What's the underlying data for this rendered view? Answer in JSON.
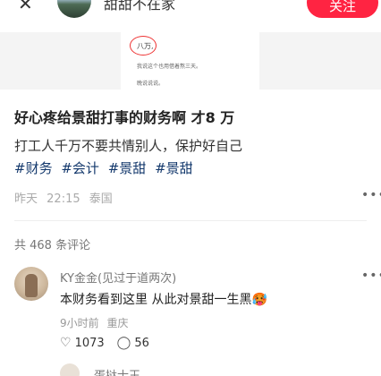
{
  "topbar": {
    "close_icon": "close-icon",
    "username": "甜甜不在家",
    "follow_label": "关注",
    "accent": "#ff2442"
  },
  "preview": {
    "line1": "八万,",
    "line2": "我说这个也用借着熬三天。",
    "line3": "晚说说说。"
  },
  "post": {
    "title": "好心疼给景甜打事的财务啊 才8 万",
    "description": "打工人千万不要共情别人，保护好自己",
    "tags": [
      "#财务",
      "#会计",
      "#景甜",
      "#景甜"
    ],
    "tag_color": "#13386c",
    "date": "昨天",
    "time": "22:15",
    "location": "泰国"
  },
  "comments_header": {
    "count_text": "共 468 条评论"
  },
  "comment": {
    "name": "KY金金(见过于道两次)",
    "text": "本财务看到这里 从此对景甜一生黑🥵",
    "time": "9小时前",
    "location": "重庆",
    "likes": "1073",
    "replies": "56",
    "like_icon": "heart-icon",
    "reply_icon": "comment-bubble-icon"
  },
  "comment2": {
    "name": "蛋挞士王"
  }
}
